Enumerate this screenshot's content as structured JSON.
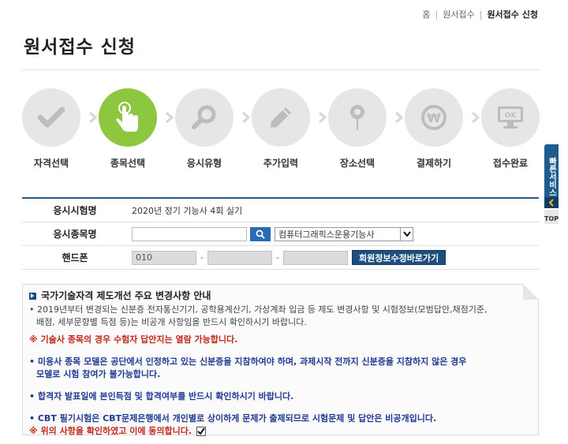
{
  "breadcrumb": {
    "home": "홈",
    "level1": "원서접수",
    "current": "원서접수 신청"
  },
  "page": {
    "title": "원서접수 신청"
  },
  "steps": [
    {
      "label": "자격선택",
      "icon": "check-icon",
      "active": false
    },
    {
      "label": "종목선택",
      "icon": "hand-pointer-icon",
      "active": true
    },
    {
      "label": "응시유형",
      "icon": "magnifier-icon",
      "active": false
    },
    {
      "label": "추가입력",
      "icon": "pencil-icon",
      "active": false
    },
    {
      "label": "장소선택",
      "icon": "location-pin-icon",
      "active": false
    },
    {
      "label": "결제하기",
      "icon": "won-coin-icon",
      "active": false
    },
    {
      "label": "접수완료",
      "icon": "monitor-ok-icon",
      "active": false
    }
  ],
  "step_icon_text": {
    "ok": "OK",
    "won": "₩"
  },
  "sidebar": {
    "quick_label": "빠른서비스",
    "top_label": "TOP"
  },
  "form": {
    "exam_name_label": "응시시험명",
    "exam_name_value": "2020년 정기 기능사 4회 실기",
    "subject_label": "응시종목명",
    "subject_input_value": "",
    "subject_select_value": "컴퓨터그래픽스운용기능사",
    "phone_label": "핸드폰",
    "phone_part1": "010",
    "phone_part2": "",
    "phone_part3": "",
    "dash": "-",
    "member_info_button": "회원정보수정바로가기"
  },
  "notice": {
    "title": "국가기술자격 제도개선 주요 변경사항 안내",
    "line1": "• 2019년부터 변경되는 신분증 전자통신기기, 공학용계산기, 가상계좌 입금 등 제도 변경사항 및 시험정보(모범답안,채점기준,",
    "line2": "배점, 세부문항별 득점 등)는 비공개 사항임을 반드시 확인하시기 바랍니다.",
    "line3": "※ 기술사 종목의 경우 수험자 답안지는 열람 가능합니다.",
    "line4": "• 미응사 종목 모델은 공단에서 인정하고 있는 신분증을 지참하여야 하며, 과제시작 전까지 신분증을 지참하지 않은 경우",
    "line5": "모델로 시험 참여가 불가능합니다.",
    "line6": "• 합격자 발표일에 본인득점 및 합격여부를 반드시 확인하시기 바랍니다.",
    "line7": "• CBT 필기시험은 CBT문제은행에서 개인별로 상이하게 문제가 출제되므로 시험문제 및 답안은 비공개입니다.",
    "agree_text": "※ 위의 사항을 확인하였고 이에 동의합니다.",
    "agree_checked": true
  },
  "colors": {
    "active_step": "#8dc63f",
    "inactive_step": "#e6e6e6",
    "primary_blue": "#1d4e7e",
    "warning_red": "#c2271b",
    "info_blue": "#1f3a93"
  }
}
